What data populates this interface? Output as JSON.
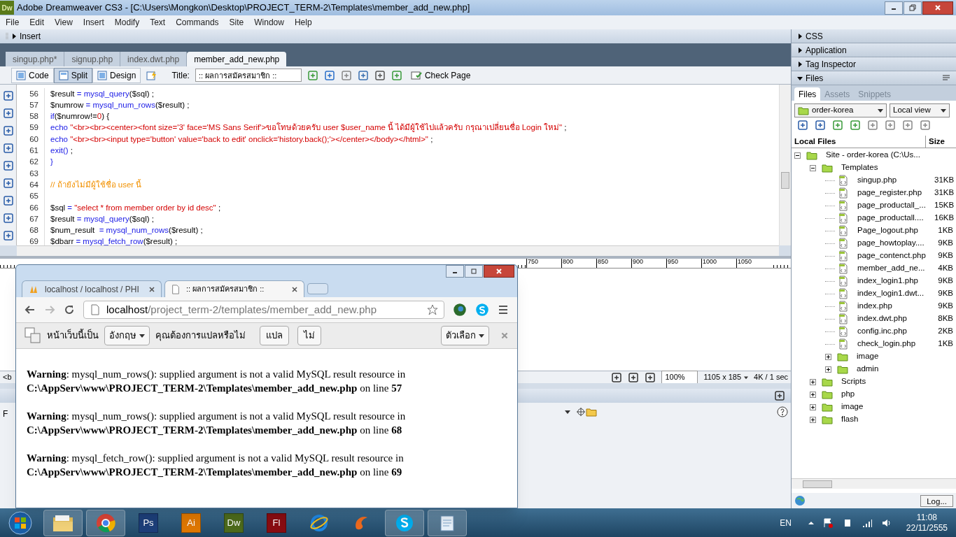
{
  "window": {
    "app_icon": "Dw",
    "title": "Adobe Dreamweaver CS3 - [C:\\Users\\Mongkon\\Desktop\\PROJECT_TERM-2\\Templates\\member_add_new.php]"
  },
  "menu": [
    "File",
    "Edit",
    "View",
    "Insert",
    "Modify",
    "Text",
    "Commands",
    "Site",
    "Window",
    "Help"
  ],
  "insert_bar": {
    "label": "Insert",
    "expanded": false
  },
  "doc_tabs": [
    {
      "label": "singup.php*",
      "selected": false
    },
    {
      "label": "signup.php",
      "selected": false
    },
    {
      "label": "index.dwt.php",
      "selected": false
    },
    {
      "label": "member_add_new.php",
      "selected": true
    }
  ],
  "doc_toolbar": {
    "views": [
      {
        "label": "Code",
        "selected": false
      },
      {
        "label": "Split",
        "selected": true
      },
      {
        "label": "Design",
        "selected": false
      }
    ],
    "title_label": "Title:",
    "title_value": ":: ผลการสมัครสมาชิก ::",
    "check_page": "Check Page"
  },
  "code": {
    "lines": [
      {
        "number": "56",
        "tokens": [
          {
            "kind": "plain",
            "text": "$result"
          },
          {
            "kind": "func",
            "text": " = mysql_query"
          },
          {
            "kind": "plain",
            "text": "($sql) ;"
          }
        ]
      },
      {
        "number": "57",
        "tokens": [
          {
            "kind": "plain",
            "text": "$numrow"
          },
          {
            "kind": "func",
            "text": " = mysql_num_rows"
          },
          {
            "kind": "plain",
            "text": "($result) ;"
          }
        ]
      },
      {
        "number": "58",
        "tokens": [
          {
            "kind": "func",
            "text": "if"
          },
          {
            "kind": "plain",
            "text": "($numrow!="
          },
          {
            "kind": "str",
            "text": "0"
          },
          {
            "kind": "plain",
            "text": ") {"
          }
        ]
      },
      {
        "number": "59",
        "tokens": [
          {
            "kind": "func",
            "text": "echo "
          },
          {
            "kind": "str",
            "text": "\"<br><br><center><font size='3' face='MS Sans Serif'>ขอโทษด้วยครับ user $user_name นี้ ได้มีผู้ใช้ไปแล้วครับ กรุณาเปลี่ยนชื่อ Login ใหม่\""
          },
          {
            "kind": "plain",
            "text": " ;"
          }
        ]
      },
      {
        "number": "60",
        "tokens": [
          {
            "kind": "func",
            "text": "echo "
          },
          {
            "kind": "str",
            "text": "\"<br><br><input type='button' value='back to edit' onclick='history.back();'></center></body></html>\""
          },
          {
            "kind": "plain",
            "text": " ;"
          }
        ]
      },
      {
        "number": "61",
        "tokens": [
          {
            "kind": "func",
            "text": "exit()"
          },
          {
            "kind": "plain",
            "text": " ;"
          }
        ]
      },
      {
        "number": "62",
        "tokens": [
          {
            "kind": "func",
            "text": "}"
          }
        ]
      },
      {
        "number": "63"
      },
      {
        "number": "64",
        "tokens": [
          {
            "kind": "comment",
            "text": "// ถ้ายังไม่มีผู้ใช้ชื่อ user นี้"
          }
        ]
      },
      {
        "number": "65"
      },
      {
        "number": "66",
        "tokens": [
          {
            "kind": "plain",
            "text": "$sql"
          },
          {
            "kind": "func",
            "text": " = "
          },
          {
            "kind": "str",
            "text": "\"select * from member order by id desc\""
          },
          {
            "kind": "plain",
            "text": " ;"
          }
        ]
      },
      {
        "number": "67",
        "tokens": [
          {
            "kind": "plain",
            "text": "$result"
          },
          {
            "kind": "func",
            "text": " = mysql_query"
          },
          {
            "kind": "plain",
            "text": "($sql) ;"
          }
        ]
      },
      {
        "number": "68",
        "tokens": [
          {
            "kind": "plain",
            "text": "$num_result"
          },
          {
            "kind": "func",
            "text": "  = mysql_num_rows"
          },
          {
            "kind": "plain",
            "text": "($result) ;"
          }
        ]
      },
      {
        "number": "69",
        "tokens": [
          {
            "kind": "plain",
            "text": "$dbarr"
          },
          {
            "kind": "func",
            "text": " = mysql_fetch_row"
          },
          {
            "kind": "plain",
            "text": "($result) ;"
          }
        ]
      }
    ]
  },
  "design_ruler": {
    "labels": [
      "750",
      "800",
      "850",
      "900",
      "950",
      "1000",
      "1050"
    ]
  },
  "status_bar": {
    "tag": "<b",
    "zoom": "100%",
    "size": "1105 x 185",
    "download": "4K / 1 sec"
  },
  "properties": {
    "label": "F"
  },
  "panels": [
    {
      "label": "CSS",
      "expanded": false
    },
    {
      "label": "Application",
      "expanded": false
    },
    {
      "label": "Tag Inspector",
      "expanded": false
    },
    {
      "label": "Files",
      "expanded": true
    }
  ],
  "files_panel": {
    "tabs": [
      {
        "label": "Files",
        "selected": true
      },
      {
        "label": "Assets",
        "selected": false
      },
      {
        "label": "Snippets",
        "selected": false
      }
    ],
    "site": "order-korea",
    "view": "Local view",
    "columns": [
      "Local Files",
      "Size"
    ],
    "tree": [
      {
        "kind": "folder",
        "name": "Site - order-korea (C:\\Us...",
        "expanded": true,
        "children": [
          {
            "kind": "folder",
            "name": "Templates",
            "expanded": true,
            "children": [
              {
                "kind": "file",
                "name": "singup.php",
                "size": "31KB"
              },
              {
                "kind": "file",
                "name": "page_register.php",
                "size": "31KB"
              },
              {
                "kind": "file",
                "name": "page_productall_...",
                "size": "15KB"
              },
              {
                "kind": "file",
                "name": "page_productall....",
                "size": "16KB"
              },
              {
                "kind": "file",
                "name": "Page_logout.php",
                "size": "1KB"
              },
              {
                "kind": "file",
                "name": "page_howtoplay....",
                "size": "9KB"
              },
              {
                "kind": "file",
                "name": "page_contenct.php",
                "size": "9KB"
              },
              {
                "kind": "file",
                "name": "member_add_ne...",
                "size": "4KB"
              },
              {
                "kind": "file",
                "name": "index_login1.php",
                "size": "9KB"
              },
              {
                "kind": "file",
                "name": "index_login1.dwt...",
                "size": "9KB"
              },
              {
                "kind": "file",
                "name": "index.php",
                "size": "9KB"
              },
              {
                "kind": "file",
                "name": "index.dwt.php",
                "size": "8KB"
              },
              {
                "kind": "file",
                "name": "config.inc.php",
                "size": "2KB"
              },
              {
                "kind": "file",
                "name": "check_login.php",
                "size": "1KB"
              },
              {
                "kind": "folder",
                "name": "image",
                "expanded": false
              },
              {
                "kind": "folder",
                "name": "admin",
                "expanded": false
              }
            ]
          },
          {
            "kind": "folder",
            "name": "Scripts",
            "expanded": false
          },
          {
            "kind": "folder",
            "name": "php",
            "expanded": false
          },
          {
            "kind": "folder",
            "name": "image",
            "expanded": false
          },
          {
            "kind": "folder",
            "name": "flash",
            "expanded": false
          }
        ]
      }
    ],
    "log_button": "Log..."
  },
  "browser": {
    "tabs": [
      {
        "label": "localhost / localhost / PHI",
        "selected": false
      },
      {
        "label": ":: ผลการสมัครสมาชิก ::",
        "selected": true
      }
    ],
    "url_host": "localhost",
    "url_path": "/project_term-2/templates/member_add_new.php",
    "translate": {
      "prefix": "หน้าเว็บนี้เป็น",
      "language": "อังกฤษ",
      "question": "คุณต้องการแปลหรือไม่",
      "translate_button": "แปล",
      "no_button": "ไม่",
      "options": "ตัวเลือก"
    },
    "warnings": [
      {
        "line1": "**Warning**: mysql_num_rows(): supplied argument is not a valid MySQL result resource in",
        "line2": "**C:\\AppServ\\www\\PROJECT_TERM-2\\Templates\\member_add_new.php** on line **57**"
      },
      {
        "line1": "**Warning**: mysql_num_rows(): supplied argument is not a valid MySQL result resource in",
        "line2": "**C:\\AppServ\\www\\PROJECT_TERM-2\\Templates\\member_add_new.php** on line **68**"
      },
      {
        "line1": "**Warning**: mysql_fetch_row(): supplied argument is not a valid MySQL result resource in",
        "line2": "**C:\\AppServ\\www\\PROJECT_TERM-2\\Templates\\member_add_new.php** on line **69**"
      }
    ]
  },
  "taskbar": {
    "apps": [
      {
        "kind": "explorer"
      },
      {
        "kind": "chrome"
      },
      {
        "kind": "tile",
        "label": "Ps",
        "color": "#1d3f7a"
      },
      {
        "kind": "tile",
        "label": "Ai",
        "color": "#e07800"
      },
      {
        "kind": "tile",
        "label": "Dw",
        "color": "#4d6b1c"
      },
      {
        "kind": "tile",
        "label": "Fl",
        "color": "#8a0d12"
      },
      {
        "kind": "ie"
      },
      {
        "kind": "swirl"
      },
      {
        "kind": "skype"
      },
      {
        "kind": "notepad"
      }
    ],
    "language": "EN",
    "time": "11:08",
    "date": "22/11/2555"
  }
}
